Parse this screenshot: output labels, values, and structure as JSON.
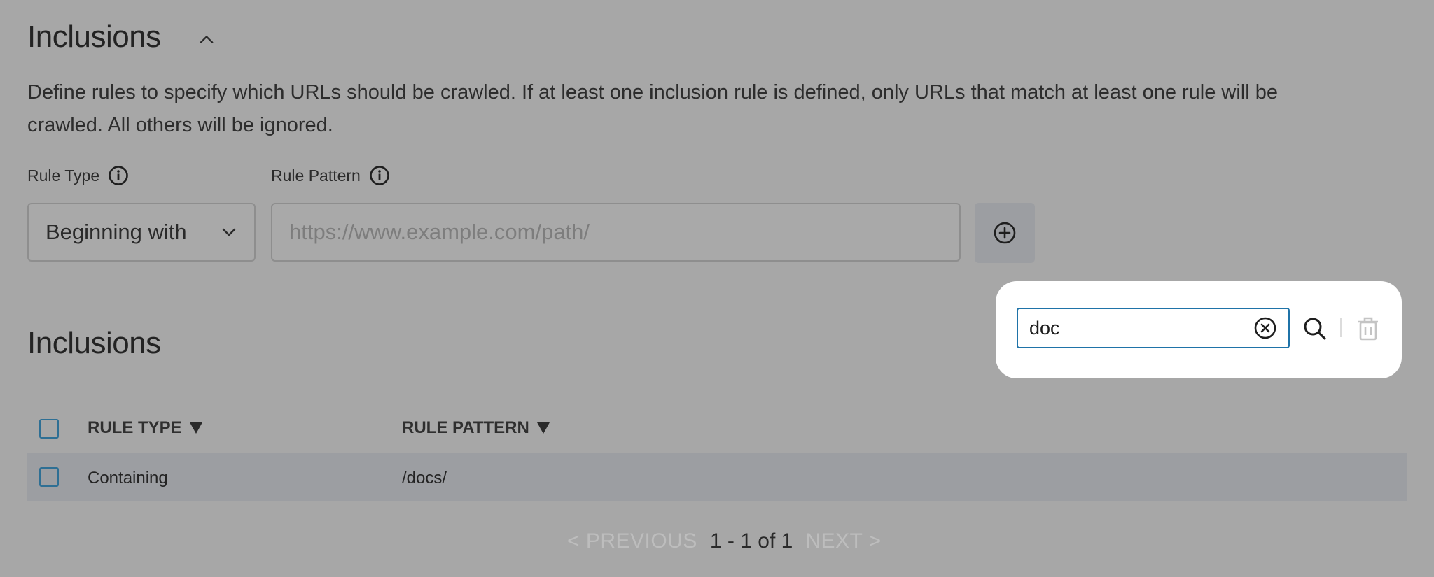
{
  "form_section": {
    "title": "Inclusions",
    "description_line1": "Define rules to specify which URLs should be crawled. If at least one inclusion rule is defined, only URLs that match at least one rule will be",
    "description_line2": "crawled. All others will be ignored.",
    "rule_type_label": "Rule Type",
    "rule_pattern_label": "Rule Pattern",
    "rule_type_value": "Beginning with",
    "rule_pattern_placeholder": "https://www.example.com/path/"
  },
  "search": {
    "value": "doc"
  },
  "list_section": {
    "title": "Inclusions",
    "columns": [
      "RULE TYPE",
      "RULE PATTERN"
    ],
    "rows": [
      {
        "rule_type": "Containing",
        "rule_pattern": "/docs/"
      }
    ]
  },
  "pagination": {
    "previous_label": "< PREVIOUS",
    "range_label": "1 - 1 of 1",
    "next_label": "NEXT >"
  },
  "icons": [
    "chevron-up-icon",
    "info-icon",
    "chevron-down-icon",
    "add-circle-icon",
    "clear-circle-icon",
    "search-icon",
    "trash-icon",
    "sort-down-icon"
  ],
  "colors": {
    "accent": "#1f73a8",
    "overlay": "#a7a7a7",
    "popup": "#ffffff"
  }
}
